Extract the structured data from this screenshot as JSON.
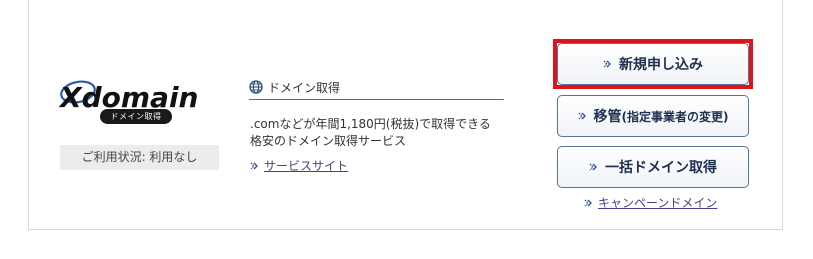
{
  "logo": {
    "brand": "Xdomain",
    "badge": "ドメイン取得"
  },
  "usage_status": "ご利用状況: 利用なし",
  "service": {
    "title": "ドメイン取得",
    "description_line1": ".comなどが年間1,180円(税抜)で取得できる",
    "description_line2": "格安のドメイン取得サービス",
    "link_label": "サービスサイト"
  },
  "buttons": {
    "new_signup": "新規申し込み",
    "transfer_main": "移管",
    "transfer_sub": "(指定事業者の変更)",
    "bulk": "一括ドメイン取得"
  },
  "campaign_link": "キャンペーンドメイン",
  "colors": {
    "highlight": "#e0121b",
    "button_border": "#54749c",
    "link": "#4a3d8f"
  }
}
